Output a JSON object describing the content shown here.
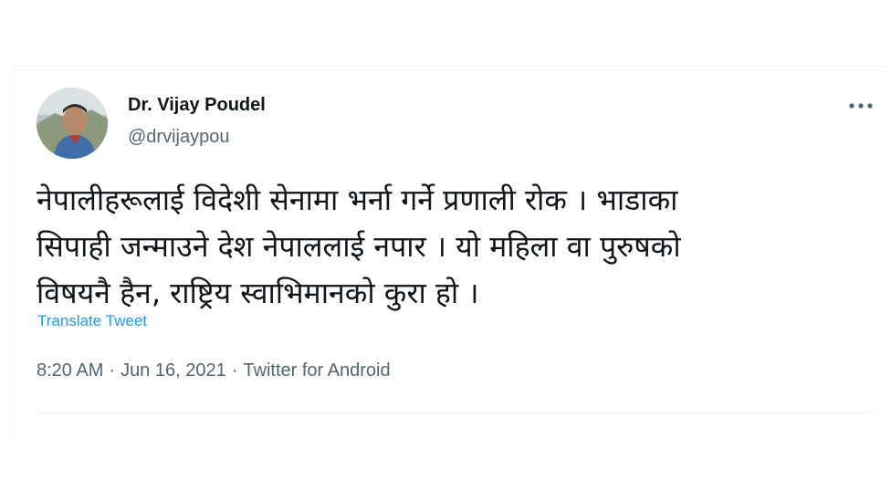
{
  "author": {
    "name": "Dr. Vijay Poudel",
    "handle": "@drvijaypou"
  },
  "tweet": {
    "lines": [
      "नेपालीहरूलाई विदेशी सेनामा भर्ना गर्ने प्रणाली रोक । भाडाका",
      "सिपाही जन्माउने देश नेपाललाई नपार । यो महिला वा पुरुषको",
      "विषयनै हैन, राष्ट्रिय स्वाभिमानको कुरा हो ।"
    ],
    "translate_label": "Translate Tweet",
    "time": "8:20 AM",
    "date": "Jun 16, 2021",
    "source": "Twitter for Android",
    "separator": "·"
  },
  "icons": {
    "more": "more-horizontal-icon",
    "avatar": "profile-photo"
  },
  "colors": {
    "text_primary": "#0f1419",
    "text_secondary": "#536471",
    "link": "#1d9bf0",
    "border": "#eff3f4"
  }
}
